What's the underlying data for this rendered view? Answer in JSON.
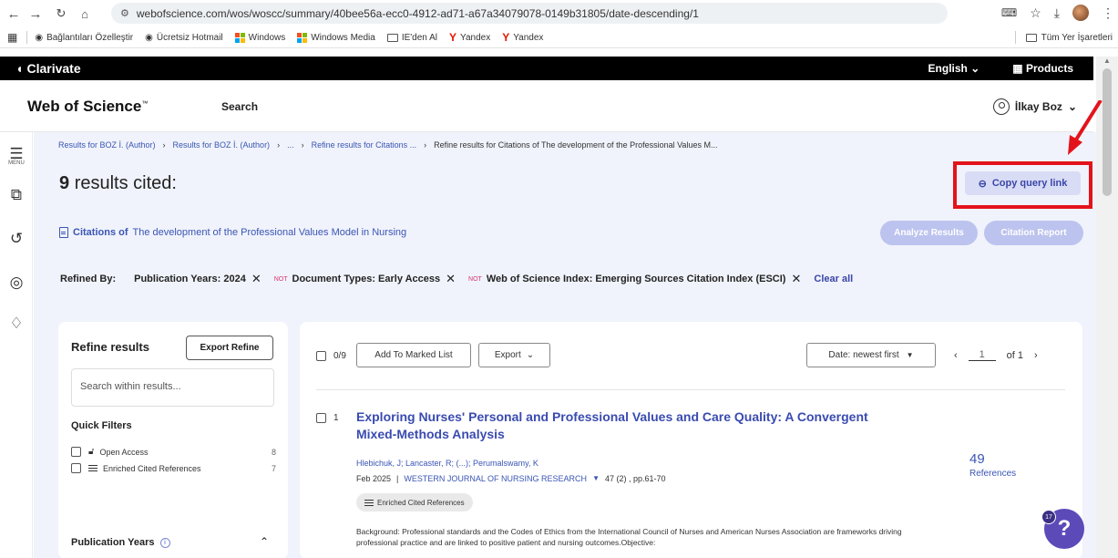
{
  "browser": {
    "url": "webofscience.com/wos/woscc/summary/40bee56a-ecc0-4912-ad71-a67a34079078-0149b31805/date-descending/1",
    "bookmarks": [
      {
        "label": "Bağlantıları Özelleştir",
        "icon": "globe-icon"
      },
      {
        "label": "Ücretsiz Hotmail",
        "icon": "globe-icon"
      },
      {
        "label": "Windows",
        "icon": "windows-icon"
      },
      {
        "label": "Windows Media",
        "icon": "windows-icon"
      },
      {
        "label": "IE'den Al",
        "icon": "folder-icon"
      },
      {
        "label": "Yandex",
        "icon": "yandex-icon"
      },
      {
        "label": "Yandex",
        "icon": "yandex-icon"
      }
    ],
    "all_bookmarks": "Tüm Yer İşaretleri"
  },
  "topbar": {
    "brand": "Clarivate",
    "language": "English",
    "products": "Products"
  },
  "header": {
    "logo": "Web of Science",
    "logo_tm": "™",
    "search": "Search",
    "user": "İlkay Boz"
  },
  "rail": {
    "menu_label": "MENU"
  },
  "breadcrumb": [
    "Results for BOZ İ. (Author)",
    "Results for BOZ İ. (Author)",
    "...",
    "Refine results for Citations ...",
    "Refine results for Citations of The development of the Professional Values M..."
  ],
  "results": {
    "count": "9",
    "suffix": "results cited:",
    "copy_query_link": "Copy query link",
    "citations_of": "Citations of",
    "citations_title": "The development of the Professional Values Model in Nursing",
    "analyze": "Analyze Results",
    "citation_report": "Citation Report"
  },
  "refined": {
    "label": "Refined By:",
    "chips": [
      {
        "not": "",
        "text": "Publication Years: 2024"
      },
      {
        "not": "NOT",
        "text": "Document Types: Early Access"
      },
      {
        "not": "NOT",
        "text": "Web of Science Index: Emerging Sources Citation Index (ESCI)"
      }
    ],
    "clear_all": "Clear all"
  },
  "refine_panel": {
    "title": "Refine results",
    "export_refine": "Export Refine",
    "search_placeholder": "Search within results...",
    "quick_filters": "Quick Filters",
    "filters": [
      {
        "label": "Open Access",
        "count": "8"
      },
      {
        "label": "Enriched Cited References",
        "count": "7"
      }
    ],
    "publication_years": "Publication Years"
  },
  "toolbar": {
    "selected": "0/9",
    "add_to_marked": "Add To Marked List",
    "export": "Export",
    "sort": "Date: newest first",
    "page": "1",
    "of_pages": "of 1"
  },
  "record": {
    "index": "1",
    "title": "Exploring Nurses' Personal and Professional Values and Care Quality: A Convergent Mixed-Methods Analysis",
    "authors": "Hlebichuk, J; Lancaster, R; (...); Perumalswamy, K",
    "date": "Feb 2025",
    "journal": "WESTERN JOURNAL OF NURSING RESEARCH",
    "volume": "47 (2) , pp.61-70",
    "badge": "Enriched Cited References",
    "abstract": "Background: Professional standards and the Codes of Ethics from the International Council of Nurses and American Nurses Association are frameworks driving professional practice and are linked to positive patient and nursing outcomes.Objective:",
    "refs_count": "49",
    "refs_label": "References"
  },
  "help": {
    "badge": "17",
    "label": "?"
  },
  "colors": {
    "accent": "#3a46a8",
    "highlight_box": "#e3131b",
    "main_bg": "#f0f3fb"
  }
}
